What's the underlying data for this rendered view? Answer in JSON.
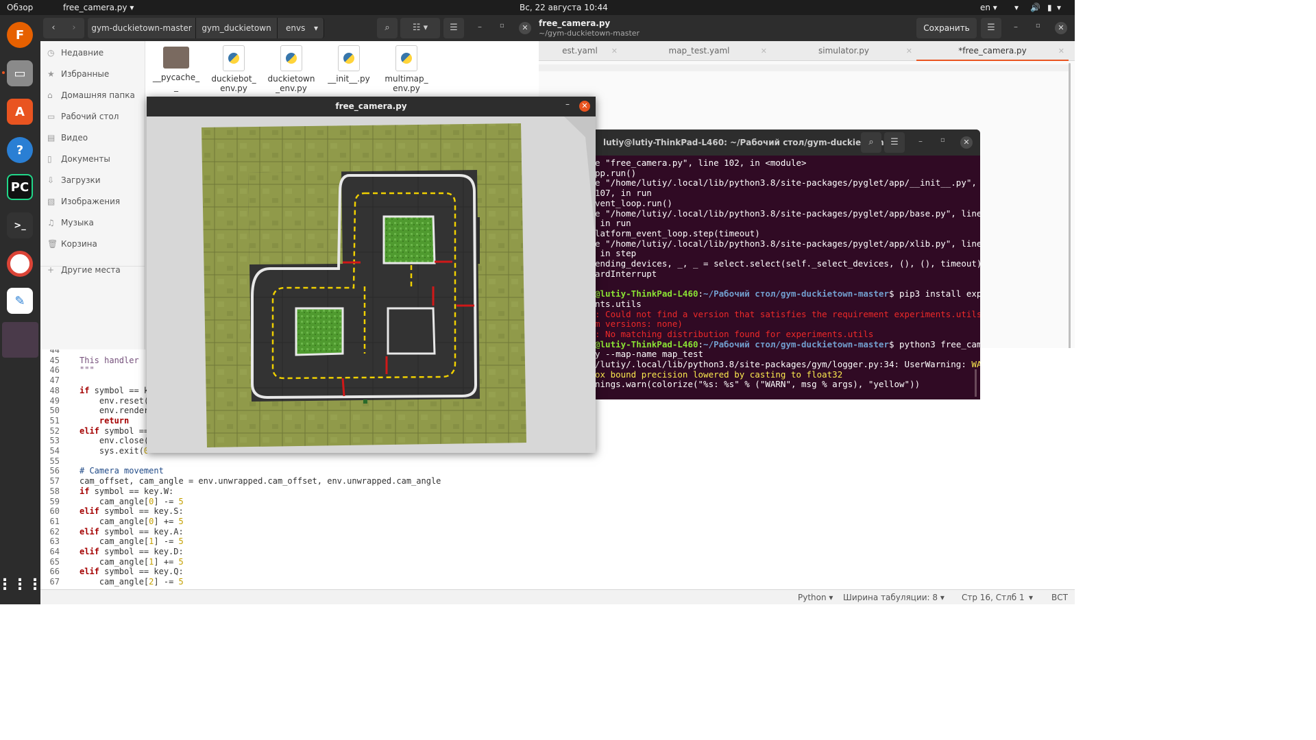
{
  "topbar": {
    "activities": "Обзор",
    "app_menu": "free_camera.py ▾",
    "clock": "Вс, 22 августа  10:44",
    "lang": "en ▾"
  },
  "gedit": {
    "title": "free_camera.py",
    "subtitle": "~/gym-duckietown-master",
    "save_label": "Сохранить",
    "tabs": [
      {
        "label": "map_test.yaml"
      },
      {
        "label": "simulator.py"
      },
      {
        "label": "*free_camera.py"
      }
    ],
    "partial_tab": "est.yaml",
    "code": [
      {
        "n": "44",
        "t": ""
      },
      {
        "n": "45",
        "t": "This handler"
      },
      {
        "n": "46",
        "t": "\"\"\""
      },
      {
        "n": "47",
        "t": ""
      },
      {
        "n": "48",
        "t": "if symbol == k"
      },
      {
        "n": "49",
        "t": "    env.reset("
      },
      {
        "n": "50",
        "t": "    env.render"
      },
      {
        "n": "51",
        "t": "    return"
      },
      {
        "n": "52",
        "t": "elif symbol =="
      },
      {
        "n": "53",
        "t": "    env.close("
      },
      {
        "n": "54",
        "t": "    sys.exit(0"
      },
      {
        "n": "55",
        "t": ""
      },
      {
        "n": "56",
        "t": "# Camera movement"
      },
      {
        "n": "57",
        "t": "cam_offset, cam_angle = env.unwrapped.cam_offset, env.unwrapped.cam_angle"
      },
      {
        "n": "58",
        "t": "if symbol == key.W:"
      },
      {
        "n": "59",
        "t": "    cam_angle[0] -= 5"
      },
      {
        "n": "60",
        "t": "elif symbol == key.S:"
      },
      {
        "n": "61",
        "t": "    cam_angle[0] += 5"
      },
      {
        "n": "62",
        "t": "elif symbol == key.A:"
      },
      {
        "n": "63",
        "t": "    cam_angle[1] -= 5"
      },
      {
        "n": "64",
        "t": "elif symbol == key.D:"
      },
      {
        "n": "65",
        "t": "    cam_angle[1] += 5"
      },
      {
        "n": "66",
        "t": "elif symbol == key.Q:"
      },
      {
        "n": "67",
        "t": "    cam_angle[2] -= 5"
      }
    ],
    "status": {
      "language": "Python ▾",
      "tab_width": "Ширина табуляции: 8 ▾",
      "position": "Стр 16, Стлб 1",
      "mode": "ВСТ"
    }
  },
  "files": {
    "breadcrumbs": [
      "gym-duckietown-master",
      "gym_duckietown",
      "envs"
    ],
    "sidebar": [
      {
        "label": "Недавние",
        "icon": "clock-icon"
      },
      {
        "label": "Избранные",
        "icon": "star-icon"
      },
      {
        "label": "Домашняя папка",
        "icon": "home-icon"
      },
      {
        "label": "Рабочий стол",
        "icon": "desktop-icon"
      },
      {
        "label": "Видео",
        "icon": "video-icon"
      },
      {
        "label": "Документы",
        "icon": "document-icon"
      },
      {
        "label": "Загрузки",
        "icon": "download-icon"
      },
      {
        "label": "Изображения",
        "icon": "image-icon"
      },
      {
        "label": "Музыка",
        "icon": "music-icon"
      },
      {
        "label": "Корзина",
        "icon": "trash-icon"
      },
      {
        "label": "Другие места",
        "icon": "plus-icon"
      }
    ],
    "items": [
      {
        "name": "__pycache_\n_",
        "kind": "folder"
      },
      {
        "name": "duckiebot_\nenv.py",
        "kind": "python"
      },
      {
        "name": "duckietown\n_env.py",
        "kind": "python"
      },
      {
        "name": "__init__.py",
        "kind": "python"
      },
      {
        "name": "multimap_\nenv.py",
        "kind": "python"
      }
    ]
  },
  "terminal": {
    "title": "lutiy@lutiy-ThinkPad-L460: ~/Рабочий стол/gym-duckietown...",
    "lines": [
      {
        "segs": [
          {
            "t": "e \"free_camera.py\", line 102, in <module>",
            "c": ""
          }
        ]
      },
      {
        "segs": [
          {
            "t": "pp.run()",
            "c": ""
          }
        ]
      },
      {
        "segs": [
          {
            "t": "e \"/home/lutiy/.local/lib/python3.8/site-packages/pyglet/app/__init__.py\",",
            "c": ""
          }
        ]
      },
      {
        "segs": [
          {
            "t": "107, in run",
            "c": ""
          }
        ]
      },
      {
        "segs": [
          {
            "t": "vent_loop.run()",
            "c": ""
          }
        ]
      },
      {
        "segs": [
          {
            "t": "e \"/home/lutiy/.local/lib/python3.8/site-packages/pyglet/app/base.py\", line",
            "c": ""
          }
        ]
      },
      {
        "segs": [
          {
            "t": " in run",
            "c": ""
          }
        ]
      },
      {
        "segs": [
          {
            "t": "latform_event_loop.step(timeout)",
            "c": ""
          }
        ]
      },
      {
        "segs": [
          {
            "t": "e \"/home/lutiy/.local/lib/python3.8/site-packages/pyglet/app/xlib.py\", line",
            "c": ""
          }
        ]
      },
      {
        "segs": [
          {
            "t": " in step",
            "c": ""
          }
        ]
      },
      {
        "segs": [
          {
            "t": "ending_devices, _, _ = select.select(self._select_devices, (), (), timeout)",
            "c": ""
          }
        ]
      },
      {
        "segs": [
          {
            "t": "ardInterrupt",
            "c": ""
          }
        ]
      },
      {
        "segs": [
          {
            "t": "",
            "c": ""
          }
        ]
      },
      {
        "segs": [
          {
            "t": "@lutiy-ThinkPad-L460",
            "c": "green"
          },
          {
            "t": ":",
            "c": ""
          },
          {
            "t": "~/Рабочий стол/gym-duckietown-master",
            "c": "blue"
          },
          {
            "t": "$ pip3 install exp",
            "c": ""
          }
        ]
      },
      {
        "segs": [
          {
            "t": "nts.utils",
            "c": ""
          }
        ]
      },
      {
        "segs": [
          {
            "t": ": Could not find a version that satisfies the requirement experiments.utils",
            "c": "red"
          }
        ]
      },
      {
        "segs": [
          {
            "t": "m versions: none)",
            "c": "red"
          }
        ]
      },
      {
        "segs": [
          {
            "t": ": No matching distribution found for experiments.utils",
            "c": "red"
          }
        ]
      },
      {
        "segs": [
          {
            "t": "@lutiy-ThinkPad-L460",
            "c": "green"
          },
          {
            "t": ":",
            "c": ""
          },
          {
            "t": "~/Рабочий стол/gym-duckietown-master",
            "c": "blue"
          },
          {
            "t": "$ python3 free_cam",
            "c": ""
          }
        ]
      },
      {
        "segs": [
          {
            "t": "y --map-name map_test",
            "c": ""
          }
        ]
      },
      {
        "segs": [
          {
            "t": "/lutiy/.local/lib/python3.8/site-packages/gym/logger.py:34: UserWarning: ",
            "c": ""
          },
          {
            "t": "WA",
            "c": "yel"
          }
        ]
      },
      {
        "segs": [
          {
            "t": "ox bound precision lowered by casting to float32",
            "c": "yel"
          }
        ]
      },
      {
        "segs": [
          {
            "t": "nings.warn(colorize(\"%s: %s\" % (\"WARN\", msg % args), \"yellow\"))",
            "c": ""
          }
        ]
      }
    ]
  },
  "free_camera": {
    "title": "free_camera.py"
  },
  "colors": {
    "accent": "#e95420",
    "terminal_bg": "#300a24",
    "grass": "#8f9a48"
  }
}
